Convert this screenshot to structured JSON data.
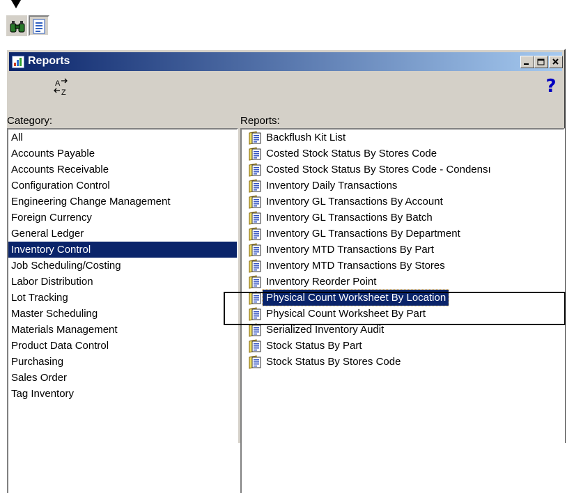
{
  "window": {
    "title": "Reports",
    "minimize_label": "_",
    "maximize_label": "□",
    "close_label": "×"
  },
  "toolbar": {
    "find_icon": "binoculars-icon",
    "reports_icon": "report-list-icon"
  },
  "window_toolbar": {
    "sort_icon": "sort-az-icon",
    "help_label": "?"
  },
  "category": {
    "label": "Category:",
    "items": [
      "All",
      "Accounts Payable",
      "Accounts Receivable",
      "Configuration Control",
      "Engineering Change Management",
      "Foreign Currency",
      "General Ledger",
      "Inventory Control",
      "Job Scheduling/Costing",
      "Labor Distribution",
      "Lot Tracking",
      "Master Scheduling",
      "Materials Management",
      "Product Data Control",
      "Purchasing",
      "Sales Order",
      "Tag Inventory"
    ],
    "selected_index": 7
  },
  "reports": {
    "label": "Reports:",
    "items": [
      "Backflush Kit List",
      "Costed Stock Status By Stores Code",
      "Costed Stock Status By Stores Code - Condensı",
      "Inventory Daily Transactions",
      "Inventory GL Transactions By Account",
      "Inventory GL Transactions By Batch",
      "Inventory GL Transactions By Department",
      "Inventory MTD Transactions By Part",
      "Inventory MTD Transactions By Stores",
      "Inventory Reorder Point",
      "Physical Count Worksheet By Location",
      "Physical Count Worksheet By Part",
      "Serialized Inventory Audit",
      "Stock Status By Part",
      "Stock Status By Stores Code"
    ],
    "selected_index": 10,
    "item_icon": "report-document-icon"
  },
  "colors": {
    "selection": "#0a246a",
    "face": "#d4d0c8"
  }
}
